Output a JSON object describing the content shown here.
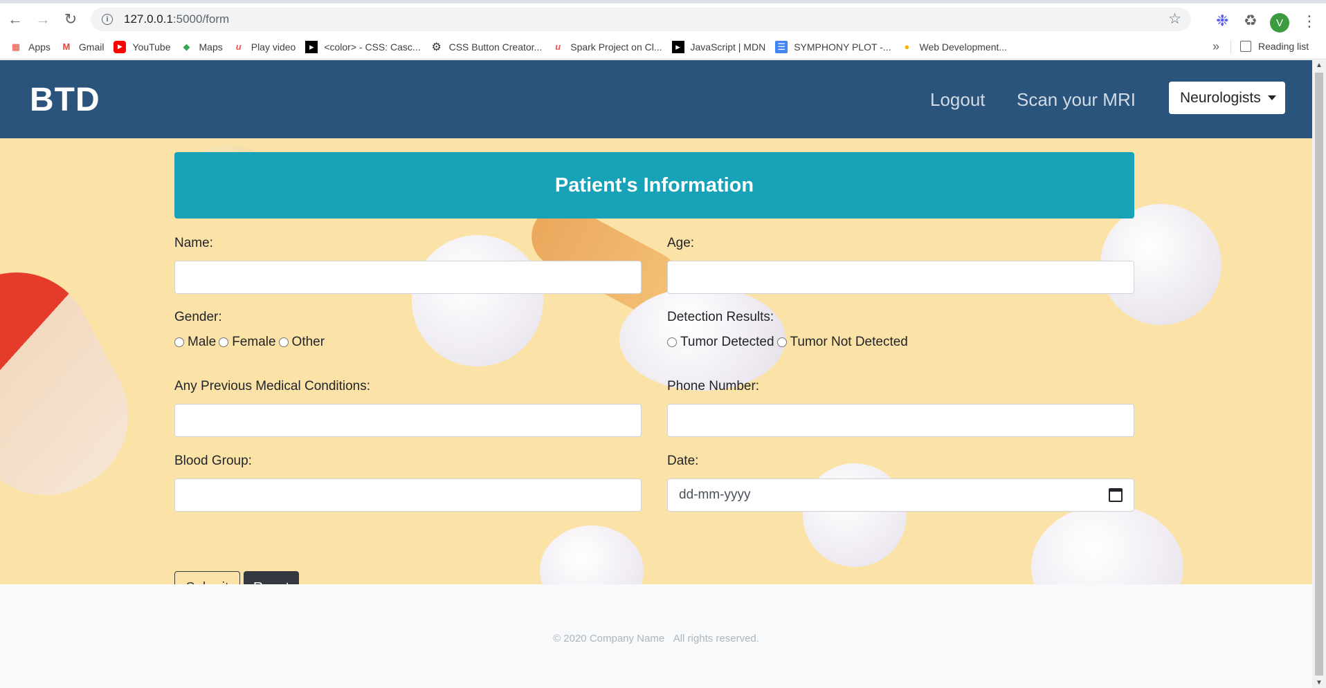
{
  "browser": {
    "url_host": "127.0.0.1",
    "url_path": ":5000/form",
    "avatar_letter": "V",
    "bookmarks": [
      "Apps",
      "Gmail",
      "YouTube",
      "Maps",
      "Play video",
      "<color> - CSS: Casc...",
      "CSS Button Creator...",
      "Spark Project on Cl...",
      "JavaScript | MDN",
      "SYMPHONY PLOT -...",
      "Web Development..."
    ],
    "more": "»",
    "reading_list": "Reading list"
  },
  "nav": {
    "brand": "BTD",
    "logout": "Logout",
    "scan": "Scan your MRI",
    "dropdown": "Neurologists"
  },
  "form": {
    "title": "Patient's Information",
    "name_label": "Name:",
    "age_label": "Age:",
    "gender_label": "Gender:",
    "gender_options": [
      "Male",
      "Female",
      "Other"
    ],
    "detection_label": "Detection Results:",
    "detection_options": [
      "Tumor Detected",
      "Tumor Not Detected"
    ],
    "conditions_label": "Any Previous Medical Conditions:",
    "phone_label": "Phone Number:",
    "blood_label": "Blood Group:",
    "date_label": "Date:",
    "date_placeholder": "dd-mm-yyyy",
    "submit": "Submit",
    "reset": "Reset"
  },
  "footer": {
    "copyright": "© 2020 Company Name",
    "rights": "All rights reserved."
  },
  "colors": {
    "navbar": "#2a547b",
    "header": "#17a2b8",
    "hero": "#fbe2a7",
    "dark_button": "#343a40"
  }
}
